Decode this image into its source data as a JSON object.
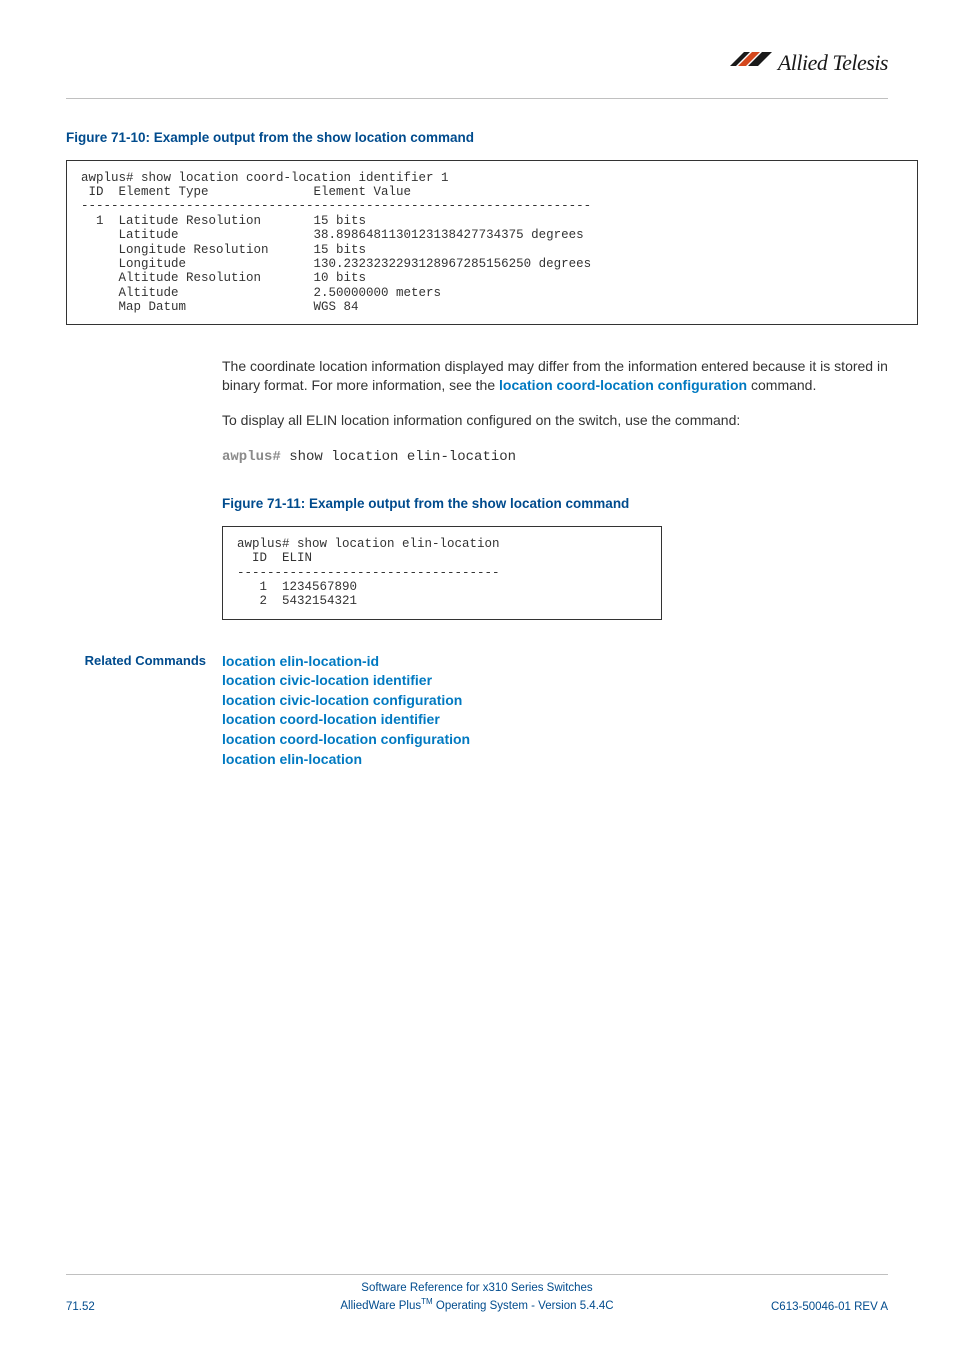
{
  "brand": {
    "name": "Allied Telesis"
  },
  "fig1": {
    "caption": "Figure 71-10: Example output from the show location command",
    "block": "awplus# show location coord-location identifier 1\n ID  Element Type              Element Value\n--------------------------------------------------------------------\n  1  Latitude Resolution       15 bits\n     Latitude                  38.8986481130123138427734375 degrees\n     Longitude Resolution      15 bits\n     Longitude                 130.2323232293128967285156250 degrees\n     Altitude Resolution       10 bits\n     Altitude                  2.50000000 meters\n     Map Datum                 WGS 84"
  },
  "para1": {
    "pre": "The coordinate location information displayed may differ from the information entered because it is stored in binary format. For more information, see the ",
    "link": "location coord-location configuration",
    "post": " command."
  },
  "para2": "To display all ELIN location information configured on the switch, use the command:",
  "prompt2": {
    "prefix": "awplus#",
    "cmd": " show location elin-location"
  },
  "fig2": {
    "caption": "Figure 71-11: Example output from the show location command",
    "block": "awplus# show location elin-location\n  ID  ELIN\n-----------------------------------\n   1  1234567890\n   2  5432154321"
  },
  "related": {
    "label": "Related Commands",
    "items": [
      "location elin-location-id",
      "location civic-location identifier",
      "location civic-location configuration",
      "location coord-location identifier",
      "location coord-location configuration",
      "location elin-location"
    ]
  },
  "footer": {
    "line1": "Software Reference for x310 Series Switches",
    "line2_pre": "AlliedWare Plus",
    "line2_tm": "TM",
    "line2_post": " Operating System  - Version 5.4.4C",
    "left": "71.52",
    "right": "C613-50046-01 REV A"
  }
}
